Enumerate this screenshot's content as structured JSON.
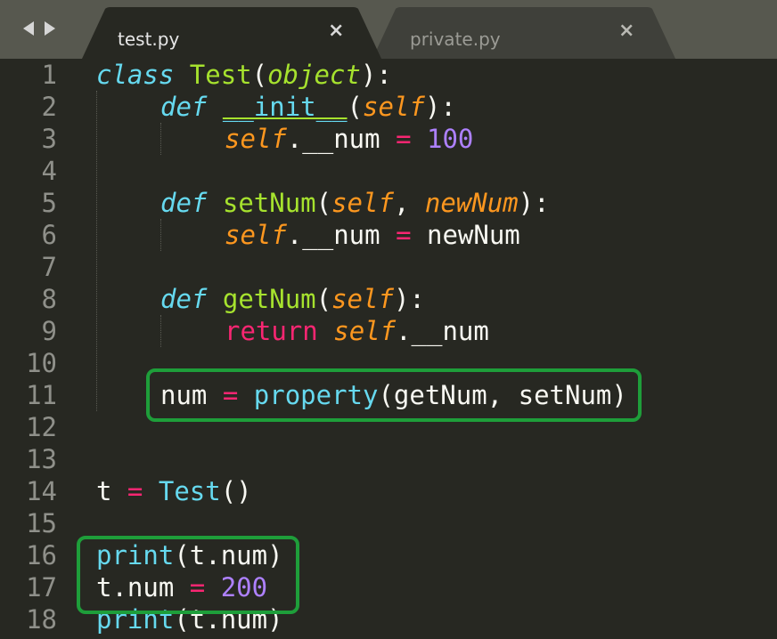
{
  "tabs": [
    {
      "label": "test.py",
      "active": true,
      "close": "×"
    },
    {
      "label": "private.py",
      "active": false,
      "close": "×"
    }
  ],
  "gutter": [
    "1",
    "2",
    "3",
    "4",
    "5",
    "6",
    "7",
    "8",
    "9",
    "10",
    "11",
    "12",
    "13",
    "14",
    "15",
    "16",
    "17",
    "18"
  ],
  "code": {
    "l1": {
      "t1": "class",
      "t2": "Test",
      "t3": "(",
      "t4": "object",
      "t5": "):"
    },
    "l2": {
      "t1": "def",
      "t2": "__init__",
      "t3": "(",
      "t4": "self",
      "t5": "):"
    },
    "l3": {
      "t1": "self",
      "t2": ".__num ",
      "t3": "=",
      "t4": "100"
    },
    "l5": {
      "t1": "def",
      "t2": "setNum",
      "t3": "(",
      "t4": "self",
      "t5": ", ",
      "t6": "newNum",
      "t7": "):"
    },
    "l6": {
      "t1": "self",
      "t2": ".__num ",
      "t3": "=",
      "t4": " newNum"
    },
    "l8": {
      "t1": "def",
      "t2": "getNum",
      "t3": "(",
      "t4": "self",
      "t5": "):"
    },
    "l9": {
      "t1": "return",
      "t2": "self",
      "t3": ".__num"
    },
    "l11": {
      "t1": "num ",
      "t2": "=",
      "t3": "property",
      "t4": "(getNum, setNum)"
    },
    "l14": {
      "t1": "t ",
      "t2": "=",
      "t3": "Test",
      "t4": "()"
    },
    "l16": {
      "t1": "print",
      "t2": "(t.num)"
    },
    "l17": {
      "t1": "t.num ",
      "t2": "=",
      "t3": "200"
    },
    "l18": {
      "t1": "print",
      "t2": "(t.num)"
    }
  },
  "colors": {
    "background": "#272822",
    "tabbar": "#57584f",
    "highlight": "#1e9e3a",
    "keyword": "#66d9ef",
    "class_name": "#a6e22e",
    "parameter": "#fd971f",
    "operator": "#f92672",
    "number": "#ae81ff"
  },
  "icons": {
    "back": "arrow-left-icon",
    "forward": "arrow-right-icon",
    "close": "close-icon"
  }
}
